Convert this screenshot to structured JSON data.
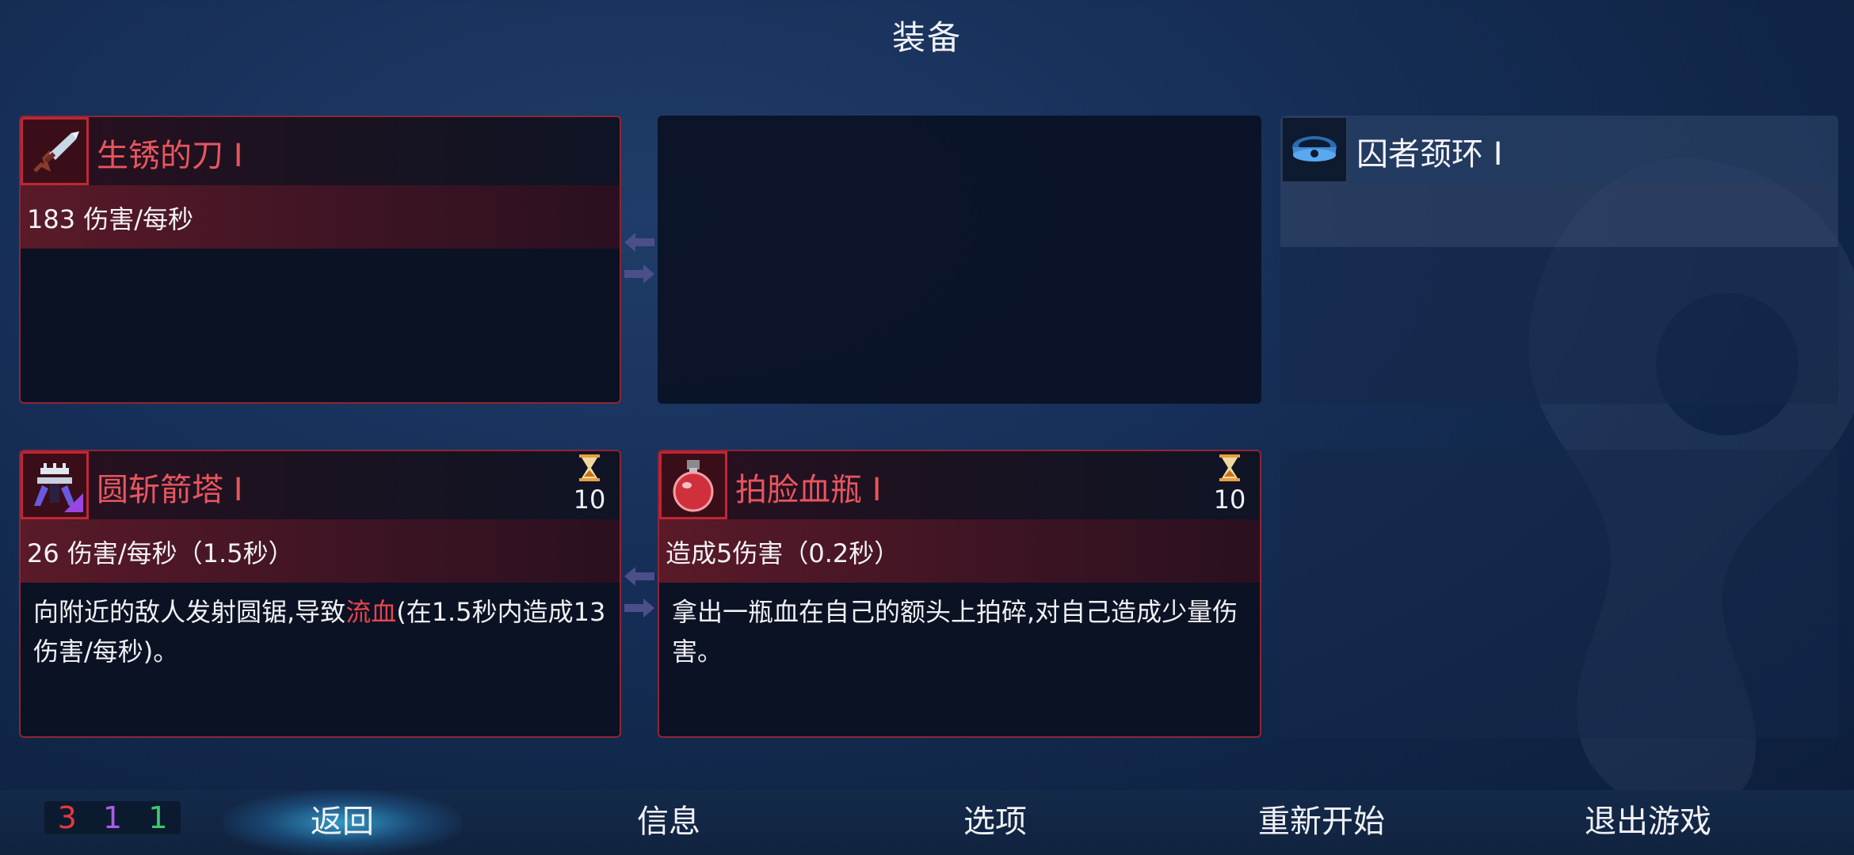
{
  "screen": {
    "title": "装备"
  },
  "slots": {
    "weapon1": {
      "name": "生锈的刀 Ⅰ",
      "stat": "183 伤害/每秒",
      "icon": "rusty-blade-icon"
    },
    "weapon2": {
      "empty": true
    },
    "amulet": {
      "name": "囚者颈环 Ⅰ",
      "stat": "",
      "icon": "prisoner-collar-icon"
    },
    "skill1": {
      "name": "圆斩箭塔 Ⅰ",
      "cooldown": "10",
      "stat": "26 伤害/每秒（1.5秒）",
      "desc_pre": "向附近的敌人发射圆锯,导致",
      "desc_highlight": "流血",
      "desc_post": "(在1.5秒内造成13伤害/每秒)。",
      "icon": "sawblade-turret-icon"
    },
    "skill2": {
      "name": "拍脸血瓶 Ⅰ",
      "cooldown": "10",
      "stat": "造成5伤害（0.2秒）",
      "desc": "拿出一瓶血在自己的额头上拍碎,对自己造成少量伤害。",
      "icon": "blood-flask-icon"
    },
    "slot6": {
      "empty": true
    }
  },
  "counters": {
    "red": "3",
    "purple": "1",
    "green": "1"
  },
  "nav": {
    "back": "返回",
    "info": "信息",
    "options": "选项",
    "restart": "重新开始",
    "quit": "退出游戏"
  },
  "colors": {
    "accent_red": "#c02636",
    "highlight_red": "#e8454e",
    "nav_active": "#3cbef0"
  }
}
